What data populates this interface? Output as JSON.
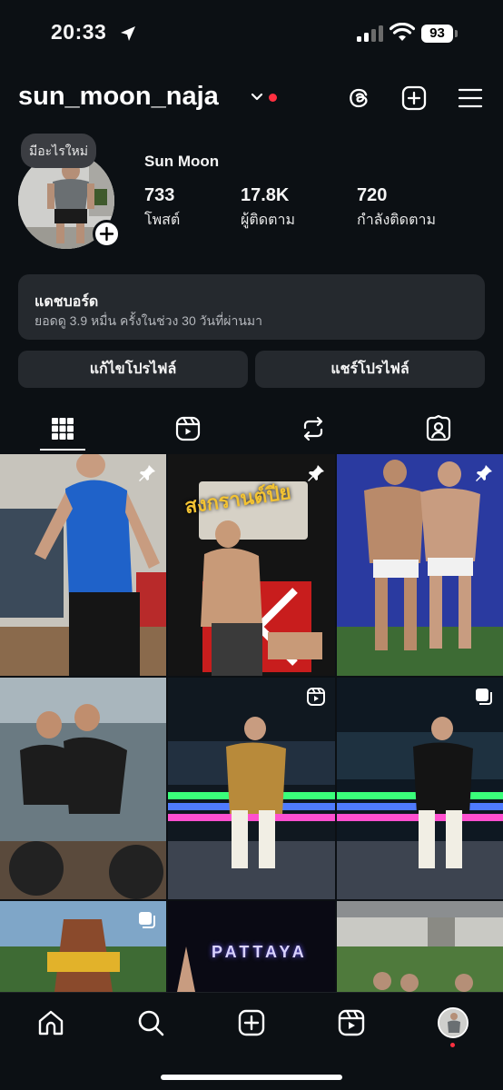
{
  "status_bar": {
    "time": "20:33",
    "battery": "93"
  },
  "header": {
    "username": "sun_moon_naja"
  },
  "profile": {
    "note": "มีอะไรใหม่",
    "display_name": "Sun Moon",
    "stats": [
      {
        "value": "733",
        "label": "โพสต์"
      },
      {
        "value": "17.8K",
        "label": "ผู้ติดตาม"
      },
      {
        "value": "720",
        "label": "กำลังติดตาม"
      }
    ]
  },
  "dashboard": {
    "title": "แดชบอร์ด",
    "subtitle": "ยอดดู 3.9 หมื่น ครั้งในช่วง 30 วันที่ผ่านมา"
  },
  "buttons": {
    "edit": "แก้ไขโปรไฟล์",
    "share": "แชร์โปรไฟล์"
  },
  "tabs": [
    "grid-icon",
    "reels-icon",
    "reposts-icon",
    "tagged-icon"
  ],
  "posts": [
    {
      "subject": "gym-post",
      "badge": "pin-icon",
      "overlay_text": ""
    },
    {
      "subject": "party-post",
      "badge": "pin-icon",
      "overlay_text": "สงกรานต์ปีย"
    },
    {
      "subject": "stage-post",
      "badge": "pin-icon",
      "overlay_text": ""
    },
    {
      "subject": "atv-post",
      "badge": "",
      "overlay_text": ""
    },
    {
      "subject": "river-boat-post",
      "badge": "reel-icon",
      "overlay_text": ""
    },
    {
      "subject": "river-boat-post-2",
      "badge": "carousel-icon",
      "overlay_text": ""
    },
    {
      "subject": "temple-post",
      "badge": "carousel-icon",
      "overlay_text": ""
    },
    {
      "subject": "pattaya-post",
      "badge": "",
      "overlay_text": "PATTAYA"
    },
    {
      "subject": "crowd-post",
      "badge": "",
      "overlay_text": ""
    }
  ],
  "colors": {
    "background": "#0c1014",
    "card": "#25292e",
    "notification": "#ff3040"
  }
}
